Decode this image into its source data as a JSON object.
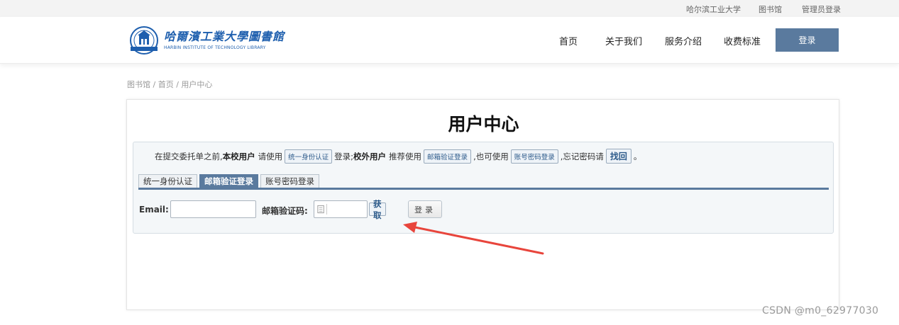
{
  "topbar": {
    "links": [
      "哈尔滨工业大学",
      "图书馆",
      "管理员登录"
    ]
  },
  "header": {
    "logo_cn": "哈爾濱工業大學圖書館",
    "logo_en": "HARBIN INSTITUTE OF TECHNOLOGY LIBRARY",
    "nav": [
      "首页",
      "关于我们",
      "服务介绍",
      "收费标准"
    ],
    "login_label": "登录"
  },
  "breadcrumb": "图书馆 / 首页 / 用户中心",
  "panel": {
    "title": "用户中心",
    "notice": {
      "p1": "在提交委托单之前,",
      "b1": "本校用户",
      "p2": "请使用",
      "btn1": "统一身份认证",
      "p3": "登录;",
      "b2": "校外用户",
      "p4": "推荐使用",
      "btn2": "邮箱验证登录",
      "p5": ",也可使用",
      "btn3": "账号密码登录",
      "p6": ",忘记密码请",
      "btn4": "找回",
      "p7": "。"
    },
    "tabs": [
      "统一身份认证",
      "邮箱验证登录",
      "账号密码登录"
    ],
    "active_tab": 1,
    "form": {
      "email_label": "Email:",
      "email_value": "",
      "code_label": "邮箱验证码:",
      "code_value": "",
      "get_code_label": "获取",
      "submit_label": "登录"
    }
  },
  "annotation": {
    "arrow_color": "#e8453c"
  },
  "watermark": "CSDN @m0_62977030",
  "colors": {
    "accent": "#5a7a9e",
    "brand_blue": "#1e5fae",
    "topbar_bg": "#f3f3f3"
  }
}
